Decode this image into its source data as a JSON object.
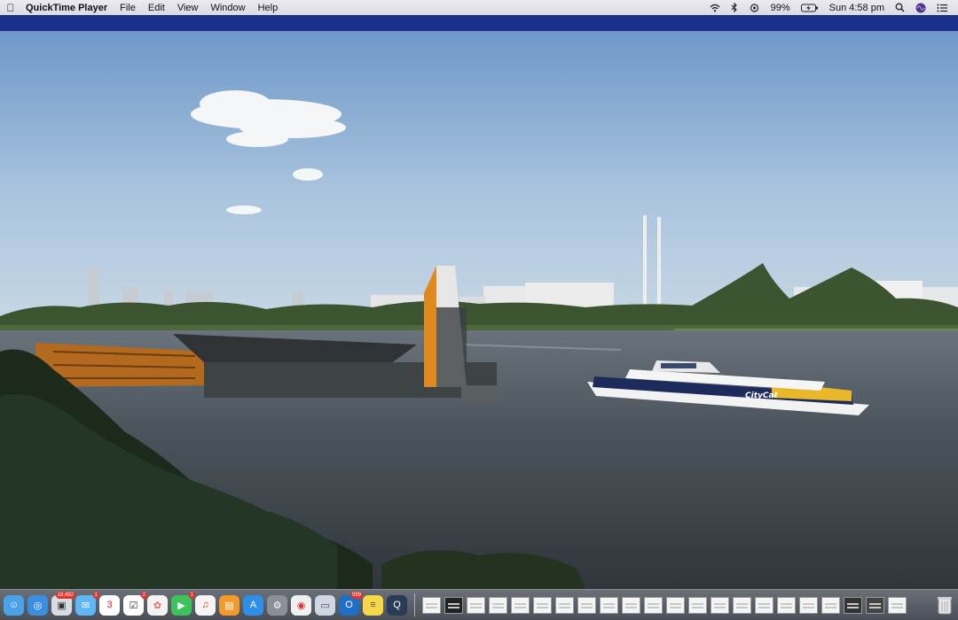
{
  "menubar": {
    "app_name": "QuickTime Player",
    "menus": [
      "File",
      "Edit",
      "View",
      "Window",
      "Help"
    ],
    "status": {
      "battery": "99%",
      "clock": "Sun 4:58 pm"
    },
    "icons": [
      "wifi-icon",
      "bluetooth-icon",
      "airplay-icon",
      "battery-icon",
      "spotlight-icon",
      "siri-icon",
      "notification-center-icon"
    ]
  },
  "video": {
    "ferry_label": "CityCat"
  },
  "dock": {
    "apps": [
      {
        "name": "finder",
        "color": "#4aa2e8",
        "glyph": "☺"
      },
      {
        "name": "safari",
        "color": "#3b8fe0",
        "glyph": "◎"
      },
      {
        "name": "photos-library",
        "color": "#d8dde4",
        "glyph": "▣",
        "badge": "18,492"
      },
      {
        "name": "messages",
        "color": "#5fb7f5",
        "glyph": "✉",
        "badge": "1"
      },
      {
        "name": "calendar",
        "color": "#ffffff",
        "glyph": "3"
      },
      {
        "name": "reminders",
        "color": "#ffffff",
        "glyph": "☑",
        "badge": "2"
      },
      {
        "name": "photos",
        "color": "#f3f3f3",
        "glyph": "✿"
      },
      {
        "name": "facetime",
        "color": "#3cc35b",
        "glyph": "▶",
        "badge": "1"
      },
      {
        "name": "music",
        "color": "#f5f5f5",
        "glyph": "♫"
      },
      {
        "name": "books",
        "color": "#f39a2c",
        "glyph": "▤"
      },
      {
        "name": "app-store",
        "color": "#2f8fe8",
        "glyph": "A"
      },
      {
        "name": "system-preferences",
        "color": "#8c8f96",
        "glyph": "⚙"
      },
      {
        "name": "chrome",
        "color": "#f0f0f0",
        "glyph": "◉"
      },
      {
        "name": "preview",
        "color": "#cfd7e2",
        "glyph": "▭"
      },
      {
        "name": "outlook",
        "color": "#1f6fc7",
        "glyph": "O",
        "badge": "999"
      },
      {
        "name": "notes",
        "color": "#f7d84a",
        "glyph": "≡"
      },
      {
        "name": "quicktime",
        "color": "#2a3b58",
        "glyph": "Q"
      }
    ],
    "documents": 22
  }
}
